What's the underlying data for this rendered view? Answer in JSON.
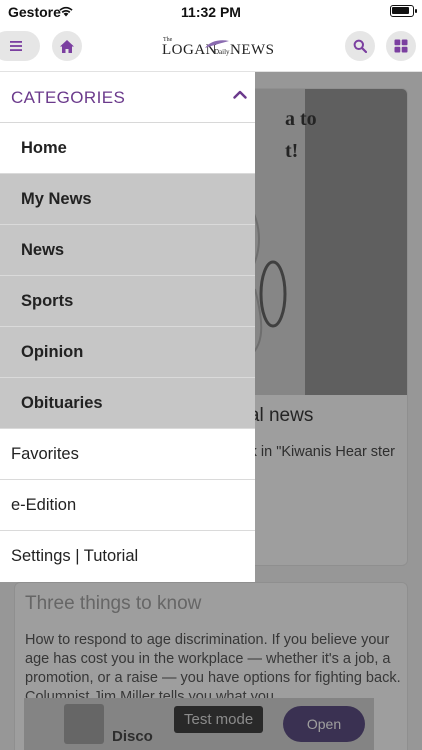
{
  "status_bar": {
    "carrier": "Gestore",
    "time": "11:32 PM",
    "battery_level": 0.9
  },
  "header": {
    "logo": {
      "the": "The",
      "logan": "LOGAN",
      "daily": "Daily",
      "news": "NEWS"
    },
    "icons": {
      "menu": "hamburger-icon",
      "home": "home-icon",
      "search": "search-icon",
      "grid": "grid-icon"
    },
    "accent_color": "#7b3fa0"
  },
  "drawer": {
    "header_label": "CATEGORIES",
    "header_icon": "chevron-up-icon",
    "categories": [
      {
        "label": "Home",
        "active": true
      },
      {
        "label": "My News",
        "active": false
      },
      {
        "label": "News",
        "active": false
      },
      {
        "label": "Sports",
        "active": false
      },
      {
        "label": "Opinion",
        "active": false
      },
      {
        "label": "Obituaries",
        "active": false
      }
    ],
    "nav_items": [
      {
        "label": "Favorites"
      },
      {
        "label": "e-Edition"
      },
      {
        "label": "Settings | Tutorial"
      }
    ]
  },
  "content": {
    "card1": {
      "image_caption_line1": "a to",
      "image_caption_line2": "t!",
      "title": "Another look at vintage local news",
      "excerpt": "ives, The Logan Daily ago last week in \"Kiwanis Hear ster Woman.\" ..."
    },
    "card2": {
      "title": "Three things to know",
      "excerpt": "How to respond to age discrimination. If you believe your age has cost you in the workplace — whether it's a job, a promotion, or a raise — you have options for fighting back. Columnist Jim Miller tells you what you"
    }
  },
  "ad_banner": {
    "label": "Disco",
    "test_mode": "Test mode",
    "open_button": "Open"
  }
}
